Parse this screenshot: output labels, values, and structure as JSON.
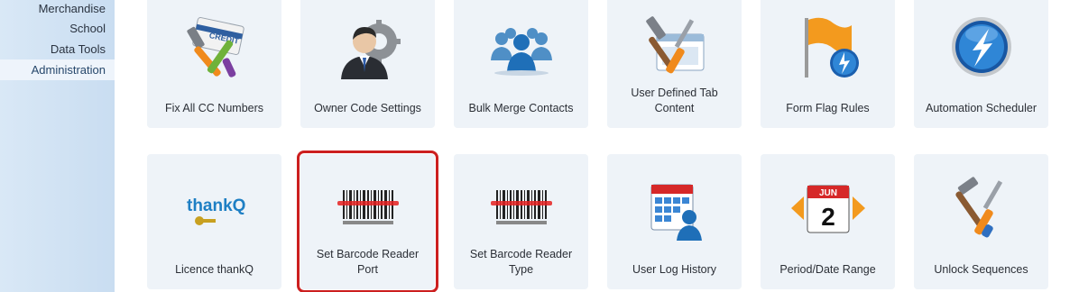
{
  "sidebar": {
    "items": [
      {
        "label": "Merchandise"
      },
      {
        "label": "School"
      },
      {
        "label": "Data Tools"
      },
      {
        "label": "Administration"
      }
    ]
  },
  "tiles": [
    {
      "label": "Fix All CC Numbers",
      "icon": "credit-card-tools-icon"
    },
    {
      "label": "Owner Code Settings",
      "icon": "businessman-gear-icon"
    },
    {
      "label": "Bulk Merge Contacts",
      "icon": "people-group-icon"
    },
    {
      "label": "User Defined Tab Content",
      "icon": "window-tools-icon"
    },
    {
      "label": "Form Flag Rules",
      "icon": "orange-flag-icon"
    },
    {
      "label": "Automation Scheduler",
      "icon": "blue-orb-lightning-icon"
    },
    {
      "label": "Licence thankQ",
      "icon": "thankq-key-icon",
      "logo_text": "thankQ"
    },
    {
      "label": "Set Barcode Reader Port",
      "icon": "barcode-icon",
      "selected": true
    },
    {
      "label": "Set Barcode Reader Type",
      "icon": "barcode-icon"
    },
    {
      "label": "User Log History",
      "icon": "calendar-user-icon"
    },
    {
      "label": "Period/Date Range",
      "icon": "calendar-date-icon",
      "calendar": {
        "month": "JUN",
        "day": "2"
      }
    },
    {
      "label": "Unlock Sequences",
      "icon": "hammer-screwdriver-icon"
    }
  ],
  "colors": {
    "sidebar_bg": "#c9ddf1",
    "tile_bg": "#eef3f8",
    "selection_border": "#cc1f1f"
  }
}
